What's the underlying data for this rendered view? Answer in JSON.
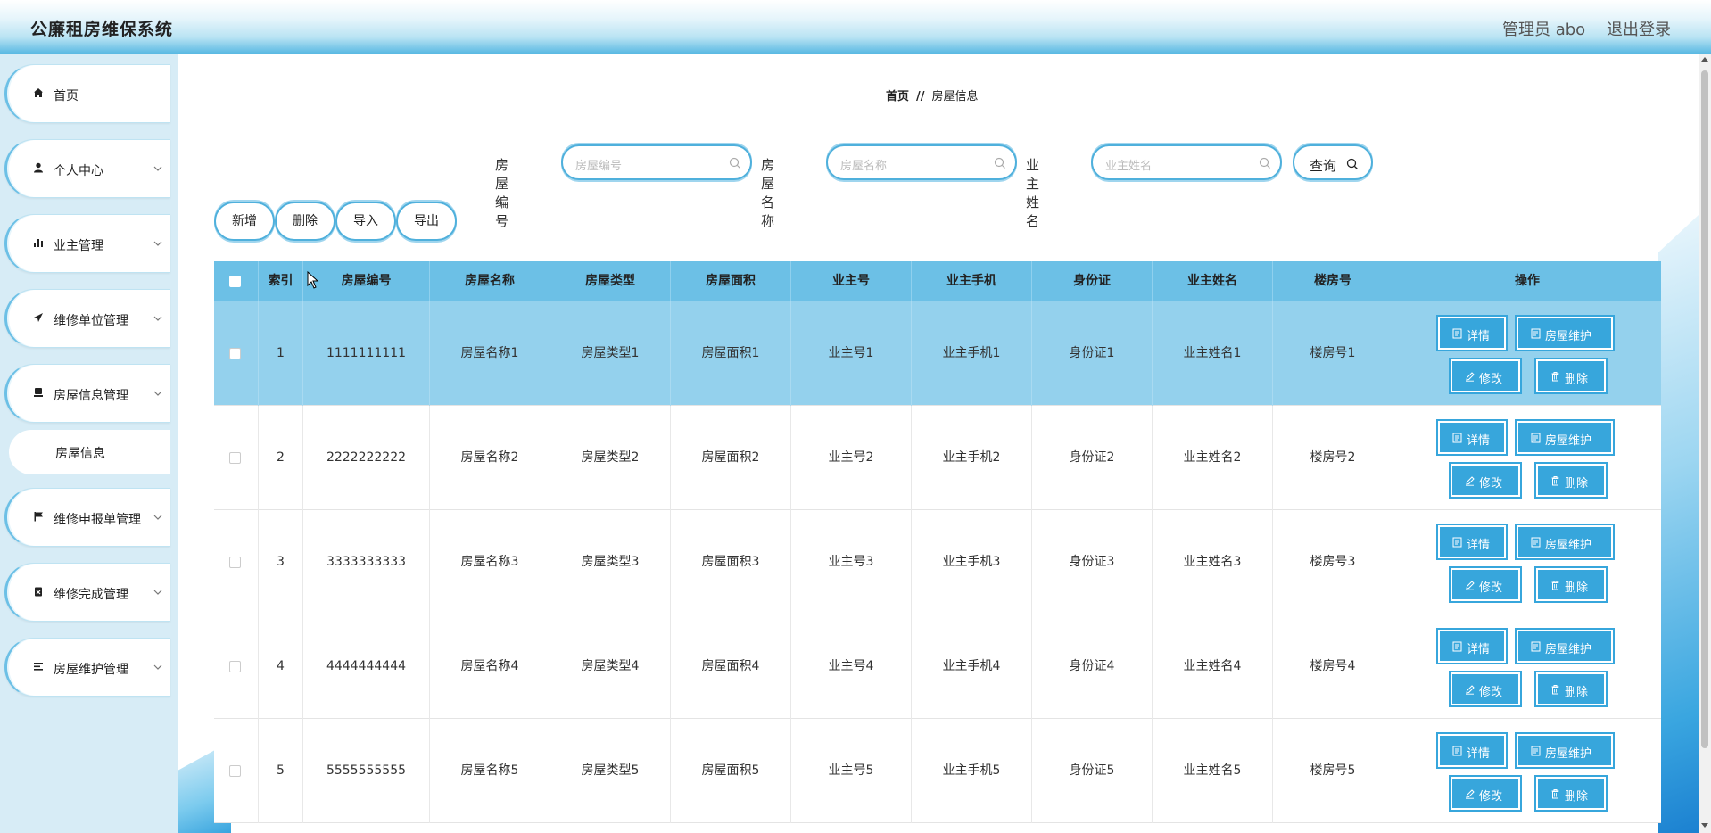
{
  "app": {
    "title": "公廉租房维保系统"
  },
  "header": {
    "admin": "管理员 abo",
    "logout": "退出登录"
  },
  "sidebar": {
    "items": [
      {
        "label": "首页",
        "icon": "home-icon"
      },
      {
        "label": "个人中心",
        "icon": "user-icon"
      },
      {
        "label": "业主管理",
        "icon": "bar-chart-icon"
      },
      {
        "label": "维修单位管理",
        "icon": "send-icon"
      },
      {
        "label": "房屋信息管理",
        "icon": "house-icon"
      },
      {
        "label": "维修申报单管理",
        "icon": "flag-icon"
      },
      {
        "label": "维修完成管理",
        "icon": "clipboard-icon"
      },
      {
        "label": "房屋维护管理",
        "icon": "list-icon"
      }
    ],
    "sub_item": "房屋信息"
  },
  "breadcrumb": {
    "home": "首页",
    "sep": "//",
    "current": "房屋信息"
  },
  "search": {
    "fields": [
      {
        "label": "房屋编号",
        "placeholder": "房屋编号"
      },
      {
        "label": "房屋名称",
        "placeholder": "房屋名称"
      },
      {
        "label": "业主姓名",
        "placeholder": "业主姓名"
      }
    ],
    "button": "查询"
  },
  "actions": {
    "add": "新增",
    "delete": "删除",
    "import": "导入",
    "export": "导出"
  },
  "table": {
    "headers": [
      "索引",
      "房屋编号",
      "房屋名称",
      "房屋类型",
      "房屋面积",
      "业主号",
      "业主手机",
      "身份证",
      "业主姓名",
      "楼房号",
      "操作"
    ],
    "rows": [
      [
        "1",
        "1111111111",
        "房屋名称1",
        "房屋类型1",
        "房屋面积1",
        "业主号1",
        "业主手机1",
        "身份证1",
        "业主姓名1",
        "楼房号1"
      ],
      [
        "2",
        "2222222222",
        "房屋名称2",
        "房屋类型2",
        "房屋面积2",
        "业主号2",
        "业主手机2",
        "身份证2",
        "业主姓名2",
        "楼房号2"
      ],
      [
        "3",
        "3333333333",
        "房屋名称3",
        "房屋类型3",
        "房屋面积3",
        "业主号3",
        "业主手机3",
        "身份证3",
        "业主姓名3",
        "楼房号3"
      ],
      [
        "4",
        "4444444444",
        "房屋名称4",
        "房屋类型4",
        "房屋面积4",
        "业主号4",
        "业主手机4",
        "身份证4",
        "业主姓名4",
        "楼房号4"
      ],
      [
        "5",
        "5555555555",
        "房屋名称5",
        "房屋类型5",
        "房屋面积5",
        "业主号5",
        "业主手机5",
        "身份证5",
        "业主姓名5",
        "楼房号5"
      ]
    ],
    "row_buttons": {
      "detail": "详情",
      "maintain": "房屋维护",
      "edit": "修改",
      "delete": "删除"
    }
  },
  "colors": {
    "accent": "#37a6dc",
    "header_row": "#6cc0e6",
    "selected_row": "#94d1ed",
    "sidebar_bg": "#d7ecf6"
  }
}
